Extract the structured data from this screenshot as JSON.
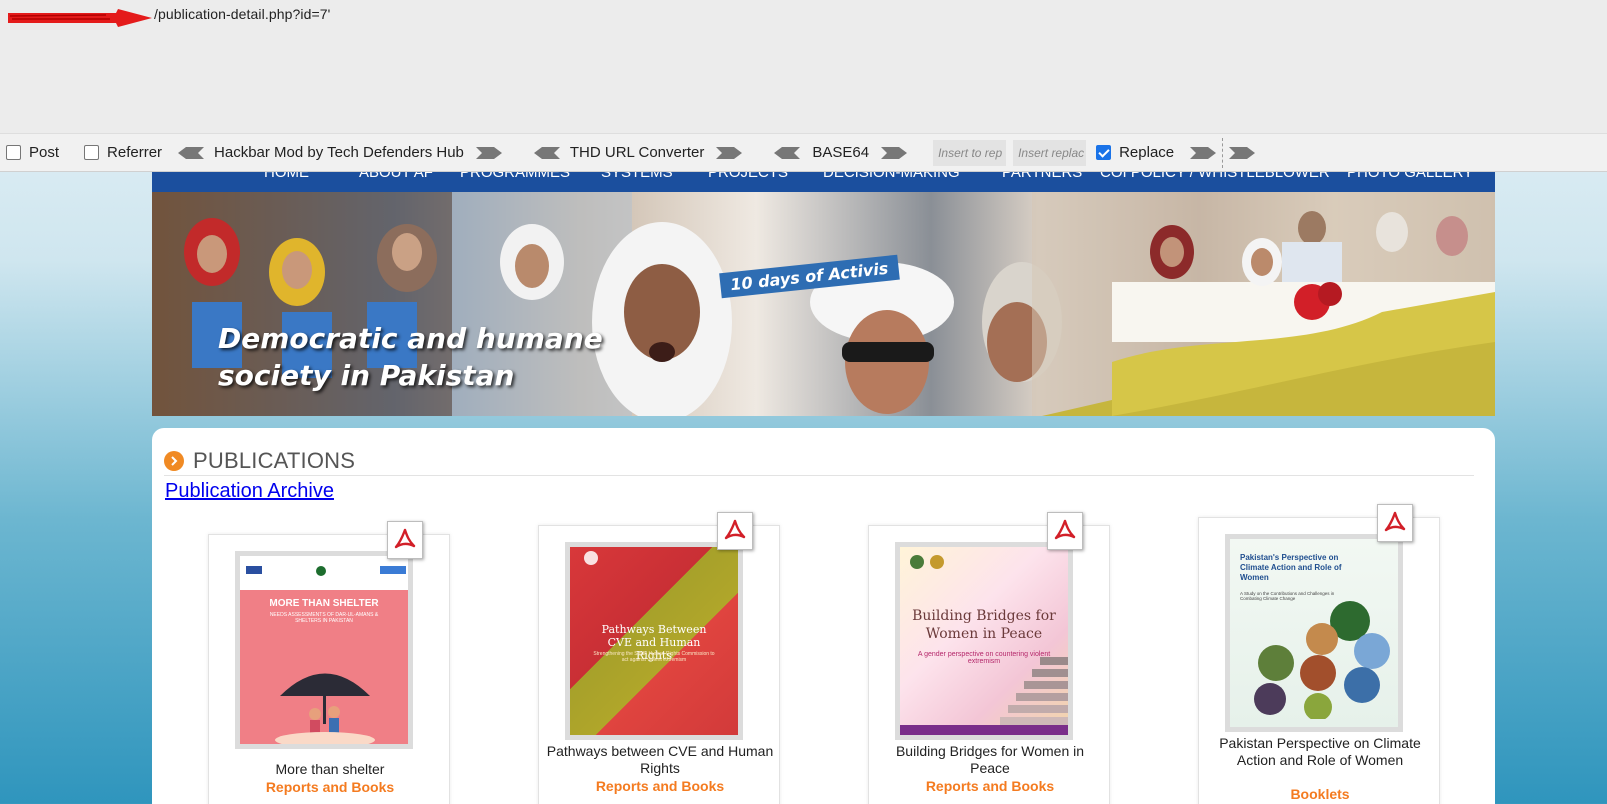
{
  "hackbar": {
    "url_text": "/publication-detail.php?id=7'",
    "post_label": "Post",
    "referrer_label": "Referrer",
    "hackbar_mod_label": "Hackbar Mod by Tech Defenders Hub",
    "url_converter_label": "THD URL Converter",
    "base64_label": "BASE64",
    "insert_placeholder": "Insert to rep",
    "replace_placeholder": "Insert replac",
    "replace_label": "Replace",
    "post_checked": false,
    "referrer_checked": false,
    "replace_checked": true
  },
  "nav": {
    "items": [
      {
        "label": "HOME"
      },
      {
        "label": "ABOUT AF"
      },
      {
        "label": "PROGRAMMES"
      },
      {
        "label": "SYSTEMS"
      },
      {
        "label": "PROJECTS"
      },
      {
        "label": "DECISION-MAKING"
      },
      {
        "label": "PARTNERS"
      },
      {
        "label": "COI POLICY / WHISTLEBLOWER"
      },
      {
        "label": "PHOTO GALLERY"
      }
    ]
  },
  "banner": {
    "line1": "Democratic and humane",
    "line2": "society in Pakistan",
    "sign_text": "10 days of Activis"
  },
  "publications": {
    "heading": "PUBLICATIONS",
    "archive_link": "Publication Archive",
    "items": [
      {
        "title": "More than shelter",
        "category": "Reports and Books",
        "cover_title": "MORE THAN SHELTER",
        "cover_sub": "NEEDS ASSESSMENTS OF DAR-UL-AMANS & SHELTERS IN PAKISTAN"
      },
      {
        "title": "Pathways between CVE and Human Rights",
        "category": "Reports and Books",
        "cover_title": "Pathways Between CVE and Human Rights",
        "cover_sub": "Strengthening the Sindh Human Rights Commission to act against violent extremism"
      },
      {
        "title": "Building Bridges for Women in Peace",
        "category": "Reports and Books",
        "cover_title": "Building Bridges for Women in Peace",
        "cover_sub": "A gender perspective on countering violent extremism"
      },
      {
        "title": "Pakistan Perspective on Climate Action and Role of Women",
        "category": "Booklets",
        "cover_title": "Pakistan's Perspective on Climate Action and Role of Women",
        "cover_sub": "A Study on the Contributions and Challenges in Combating Climate Change"
      }
    ]
  },
  "colors": {
    "nav_bg": "#1b4f9e",
    "category": "#f47b20",
    "link": "#0000ee",
    "checkbox_accent": "#1a73e8"
  }
}
